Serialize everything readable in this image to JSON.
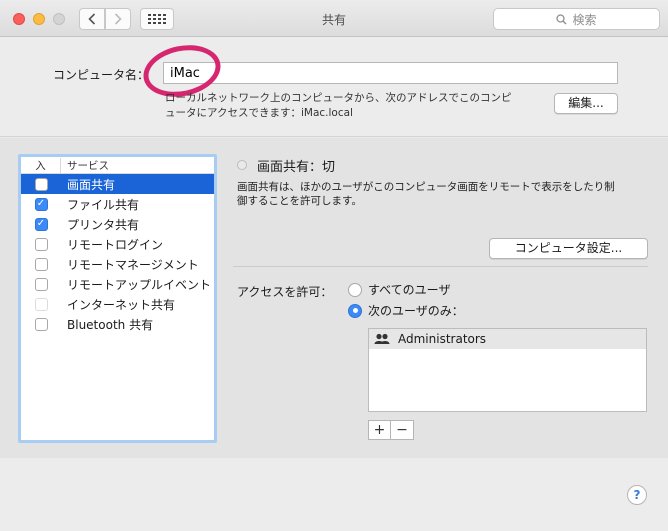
{
  "window": {
    "title": "共有"
  },
  "toolbar": {
    "search_placeholder": "検索"
  },
  "computer_name": {
    "label": "コンピュータ名：",
    "value": "iMac",
    "description_line1": "ローカルネットワーク上のコンピュータから、次のアドレスでこのコンピ",
    "description_line2": "ュータにアクセスできます：iMac.local",
    "edit_button": "編集..."
  },
  "services": {
    "header_in": "入",
    "header_service": "サービス",
    "items": [
      {
        "label": "画面共有",
        "checked": false,
        "selected": true,
        "disabled": false
      },
      {
        "label": "ファイル共有",
        "checked": true,
        "selected": false,
        "disabled": false
      },
      {
        "label": "プリンタ共有",
        "checked": true,
        "selected": false,
        "disabled": false
      },
      {
        "label": "リモートログイン",
        "checked": false,
        "selected": false,
        "disabled": false
      },
      {
        "label": "リモートマネージメント",
        "checked": false,
        "selected": false,
        "disabled": false
      },
      {
        "label": "リモートアップルイベント",
        "checked": false,
        "selected": false,
        "disabled": false
      },
      {
        "label": "インターネット共有",
        "checked": false,
        "selected": false,
        "disabled": true
      },
      {
        "label": "Bluetooth 共有",
        "checked": false,
        "selected": false,
        "disabled": false
      }
    ]
  },
  "detail": {
    "status": "画面共有：切",
    "description_line1": "画面共有は、ほかのユーザがこのコンピュータ画面をリモートで表示をしたり制",
    "description_line2": "御することを許可します。",
    "settings_button": "コンピュータ設定...",
    "access_label": "アクセスを許可：",
    "radio_all": "すべてのユーザ",
    "radio_only": "次のユーザのみ：",
    "selected_radio": "only",
    "users": [
      "Administrators"
    ],
    "add_label": "+",
    "remove_label": "−"
  },
  "help": {
    "label": "?"
  },
  "colors": {
    "selection": "#1b64d8",
    "checkbox_checked": "#3b8af7",
    "annotation": "#d6266f",
    "list_focus_ring": "#a9ccf2"
  },
  "icons": {
    "back": "chevron-left-icon",
    "forward": "chevron-right-icon",
    "grid": "grid-icon",
    "search": "search-icon",
    "user_group": "user-group-icon",
    "help": "help-icon"
  }
}
